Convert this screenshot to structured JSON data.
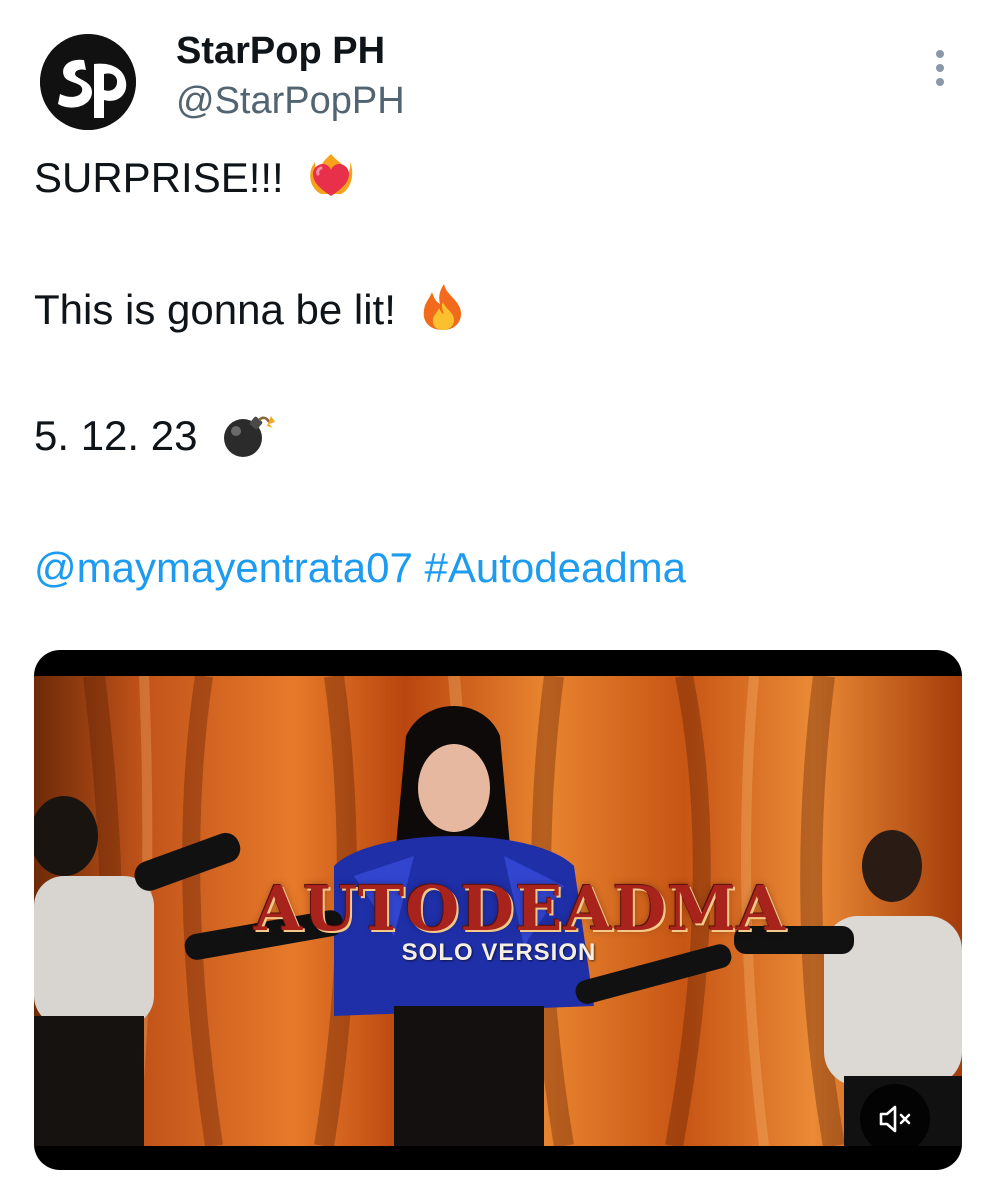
{
  "tweet": {
    "author": {
      "name": "StarPop PH",
      "handle": "@StarPopPH",
      "avatar_icon": "starpop-logo"
    },
    "lines": [
      {
        "text": "SURPRISE!!!",
        "emoji": "heart-on-fire-icon"
      },
      {
        "text": "This is gonna be lit!",
        "emoji": "fire-icon"
      },
      {
        "text": "5. 12. 23",
        "emoji": "bomb-icon"
      }
    ],
    "mention": "@maymayentrata07",
    "hashtag": "#Autodeadma"
  },
  "media": {
    "title": "AUTODEADMA",
    "subtitle": "SOLO VERSION",
    "mute_icon": "speaker-muted-icon"
  },
  "colors": {
    "link": "#1d9bf0",
    "secondary_text": "#536471",
    "primary_text": "#0f1419"
  }
}
